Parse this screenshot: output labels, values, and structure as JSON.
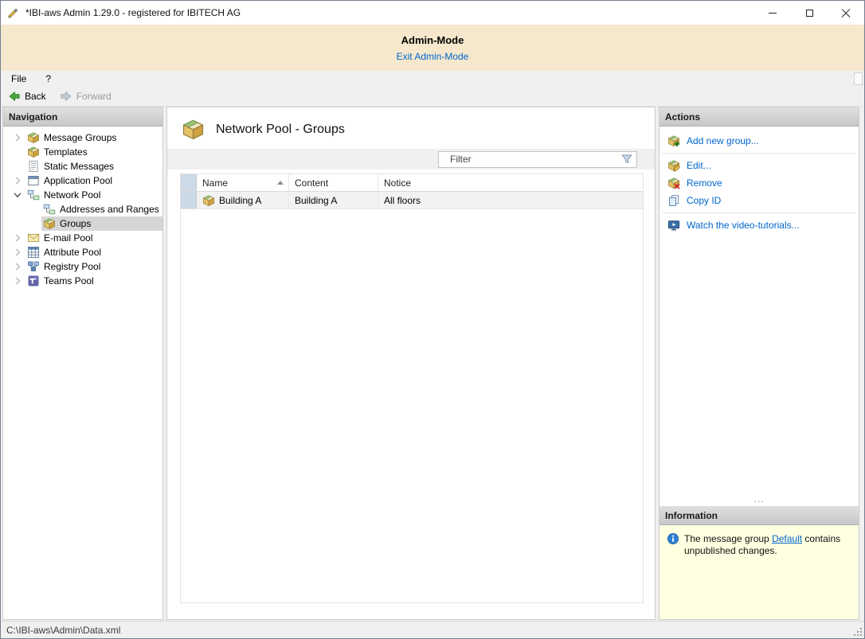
{
  "window": {
    "title": "*IBI-aws Admin 1.29.0 - registered for IBITECH AG"
  },
  "admin_banner": {
    "title": "Admin-Mode",
    "exit_link": "Exit Admin-Mode"
  },
  "menu": {
    "items": [
      "File",
      "?"
    ]
  },
  "toolbar": {
    "back": "Back",
    "forward": "Forward"
  },
  "navigation": {
    "header": "Navigation",
    "items": [
      {
        "label": "Message Groups",
        "icon": "package-icon",
        "level": 0,
        "expander": "collapsed",
        "selected": false
      },
      {
        "label": "Templates",
        "icon": "package-icon",
        "level": 0,
        "expander": "none",
        "selected": false
      },
      {
        "label": "Static Messages",
        "icon": "document-icon",
        "level": 0,
        "expander": "none",
        "selected": false
      },
      {
        "label": "Application Pool",
        "icon": "application-window-icon",
        "level": 0,
        "expander": "collapsed",
        "selected": false
      },
      {
        "label": "Network Pool",
        "icon": "network-icon",
        "level": 0,
        "expander": "expanded",
        "selected": false
      },
      {
        "label": "Addresses and Ranges",
        "icon": "network-addresses-icon",
        "level": 1,
        "expander": "none",
        "selected": false
      },
      {
        "label": "Groups",
        "icon": "package-icon",
        "level": 1,
        "expander": "none",
        "selected": true
      },
      {
        "label": "E-mail Pool",
        "icon": "envelope-icon",
        "level": 0,
        "expander": "collapsed",
        "selected": false
      },
      {
        "label": "Attribute Pool",
        "icon": "grid-icon",
        "level": 0,
        "expander": "collapsed",
        "selected": false
      },
      {
        "label": "Registry Pool",
        "icon": "registry-icon",
        "level": 0,
        "expander": "collapsed",
        "selected": false
      },
      {
        "label": "Teams Pool",
        "icon": "teams-icon",
        "level": 0,
        "expander": "collapsed",
        "selected": false
      }
    ]
  },
  "content": {
    "title": "Network Pool - Groups",
    "title_icon": "package-icon",
    "filter": {
      "placeholder": "Filter",
      "icon": "funnel-icon"
    },
    "table": {
      "columns": [
        "Name",
        "Content",
        "Notice"
      ],
      "sort": {
        "column": "Name",
        "direction": "asc"
      },
      "rows": [
        {
          "name": "Building A",
          "content": "Building A",
          "notice": "All floors",
          "icon": "package-icon",
          "selected": true
        }
      ]
    }
  },
  "actions": {
    "header": "Actions",
    "items": [
      {
        "label": "Add new group...",
        "icon": "package-add-icon"
      },
      {
        "label": "Edit...",
        "icon": "package-edit-icon"
      },
      {
        "label": "Remove",
        "icon": "package-remove-icon"
      },
      {
        "label": "Copy ID",
        "icon": "copy-icon"
      },
      {
        "label": "Watch the video-tutorials...",
        "icon": "video-icon"
      }
    ],
    "more_indicator": "..."
  },
  "information": {
    "header": "Information",
    "message": {
      "before": "The message group ",
      "link": "Default",
      "after": " contains unpublished changes."
    }
  },
  "statusbar": {
    "path": "C:\\IBI-aws\\Admin\\Data.xml"
  },
  "colors": {
    "accent_link": "#0066cc",
    "admin_banner_bg": "#f6e8cd",
    "info_bg": "#ffffe1",
    "selection_bg": "#d6d6d6",
    "row_gutter_bg": "#ccd9e6"
  }
}
